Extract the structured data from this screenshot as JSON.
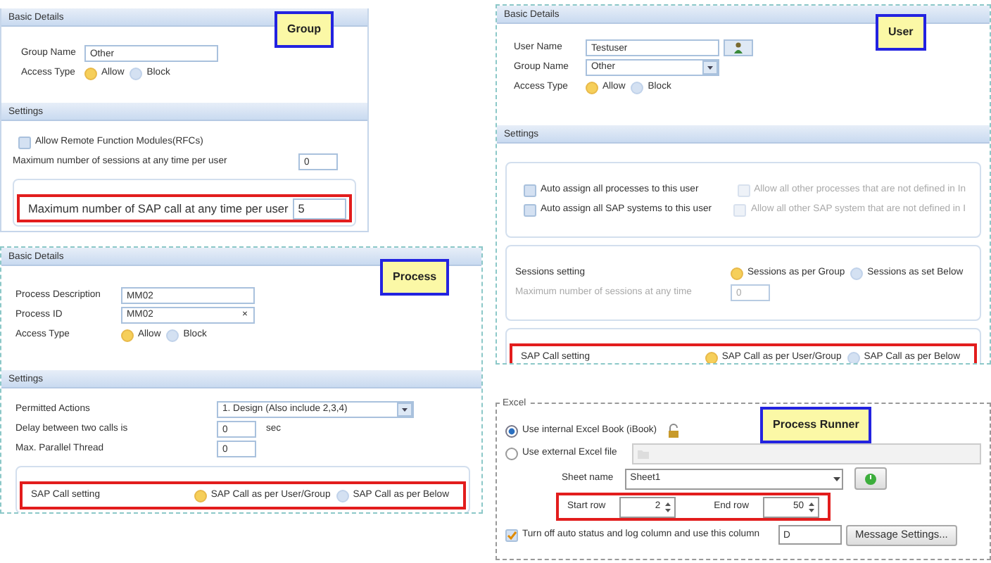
{
  "panels": [
    {
      "kind": "form",
      "tag": "Group",
      "sections": [
        {
          "title": "Basic Details",
          "blocks": [
            {
              "framed": false,
              "highlighted": false,
              "rows": [
                {
                  "kind": "text",
                  "label": "Group Name",
                  "value": "Other"
                },
                {
                  "kind": "radios",
                  "label": "Access Type",
                  "options": [
                    {
                      "label": "Allow",
                      "selected": true
                    },
                    {
                      "label": "Block",
                      "selected": false
                    }
                  ]
                }
              ]
            }
          ]
        },
        {
          "title": "Settings",
          "blocks": [
            {
              "framed": false,
              "highlighted": false,
              "rows": [
                {
                  "kind": "check",
                  "label": "Allow Remote Function Modules(RFCs)",
                  "checked": false
                },
                {
                  "kind": "number",
                  "label": "Maximum number of sessions at any time per user",
                  "value": "0"
                }
              ]
            },
            {
              "framed": true,
              "highlighted": true,
              "rows": [
                {
                  "kind": "number",
                  "label": "Maximum number of SAP call at any time per user",
                  "value": "5"
                }
              ]
            }
          ]
        }
      ]
    },
    {
      "kind": "form",
      "tag": "User",
      "sections": [
        {
          "title": "Basic Details",
          "blocks": [
            {
              "framed": false,
              "highlighted": false,
              "rows": [
                {
                  "kind": "text-button",
                  "label": "User Name",
                  "value": "Testuser"
                },
                {
                  "kind": "select",
                  "label": "Group Name",
                  "value": "Other"
                },
                {
                  "kind": "radios",
                  "label": "Access Type",
                  "options": [
                    {
                      "label": "Allow",
                      "selected": true
                    },
                    {
                      "label": "Block",
                      "selected": false
                    }
                  ]
                }
              ]
            }
          ]
        },
        {
          "title": "Settings",
          "blocks": [
            {
              "framed": true,
              "highlighted": false,
              "rows": [
                {
                  "kind": "checks",
                  "items": [
                    {
                      "label": "Auto assign all processes to this user",
                      "checked": false,
                      "disabled": false
                    },
                    {
                      "label": "Allow all other processes that are not defined in In",
                      "checked": false,
                      "disabled": true
                    }
                  ]
                },
                {
                  "kind": "checks",
                  "items": [
                    {
                      "label": "Auto assign all SAP systems to this user",
                      "checked": false,
                      "disabled": false
                    },
                    {
                      "label": "Allow all other SAP system that are not defined in I",
                      "checked": false,
                      "disabled": true
                    }
                  ]
                }
              ]
            },
            {
              "framed": true,
              "highlighted": false,
              "rows": [
                {
                  "kind": "radios",
                  "label": "Sessions setting",
                  "options": [
                    {
                      "label": "Sessions as per Group",
                      "selected": true
                    },
                    {
                      "label": "Sessions as set Below",
                      "selected": false
                    }
                  ]
                },
                {
                  "kind": "number",
                  "label": "Maximum number of sessions at any time",
                  "value": "0",
                  "disabled": true
                }
              ]
            },
            {
              "framed": true,
              "highlighted": true,
              "rows": [
                {
                  "kind": "radios",
                  "label": "SAP Call setting",
                  "options": [
                    {
                      "label": "SAP Call as per User/Group",
                      "selected": true
                    },
                    {
                      "label": "SAP Call as per Below",
                      "selected": false
                    }
                  ]
                }
              ]
            }
          ]
        }
      ]
    },
    {
      "kind": "form",
      "tag": "Process",
      "sections": [
        {
          "title": "Basic Details",
          "blocks": [
            {
              "framed": false,
              "highlighted": false,
              "rows": [
                {
                  "kind": "text",
                  "label": "Process Description",
                  "value": "MM02"
                },
                {
                  "kind": "clearable",
                  "label": "Process ID",
                  "value": "MM02",
                  "clear": "×"
                },
                {
                  "kind": "radios",
                  "label": "Access Type",
                  "options": [
                    {
                      "label": "Allow",
                      "selected": true
                    },
                    {
                      "label": "Block",
                      "selected": false
                    }
                  ]
                }
              ]
            }
          ]
        },
        {
          "title": "Settings",
          "blocks": [
            {
              "framed": false,
              "highlighted": false,
              "rows": [
                {
                  "kind": "select",
                  "label": "Permitted Actions",
                  "value": "1. Design (Also include 2,3,4)"
                },
                {
                  "kind": "number",
                  "label": "Delay between two calls is",
                  "value": "0",
                  "unit": "sec"
                },
                {
                  "kind": "number",
                  "label": "Max. Parallel Thread",
                  "value": "0"
                }
              ]
            },
            {
              "framed": true,
              "highlighted": true,
              "rows": [
                {
                  "kind": "radios",
                  "label": "SAP Call setting",
                  "options": [
                    {
                      "label": "SAP Call as per User/Group",
                      "selected": true
                    },
                    {
                      "label": "SAP Call as per Below",
                      "selected": false
                    }
                  ]
                }
              ]
            }
          ]
        }
      ]
    },
    {
      "kind": "runner",
      "tag": "Process Runner",
      "legend": "Excel",
      "sources": [
        {
          "label": "Use internal Excel Book (iBook)",
          "selected": true
        },
        {
          "label": "Use external Excel file",
          "selected": false
        }
      ],
      "sheet": {
        "label": "Sheet name",
        "value": "Sheet1"
      },
      "range": {
        "highlighted": true,
        "start": {
          "label": "Start row",
          "value": "2"
        },
        "end": {
          "label": "End row",
          "value": "50"
        }
      },
      "status_column": {
        "label": "Turn off auto status and log column and use this column",
        "checked": true,
        "value": "D"
      },
      "button": "Message Settings..."
    }
  ]
}
